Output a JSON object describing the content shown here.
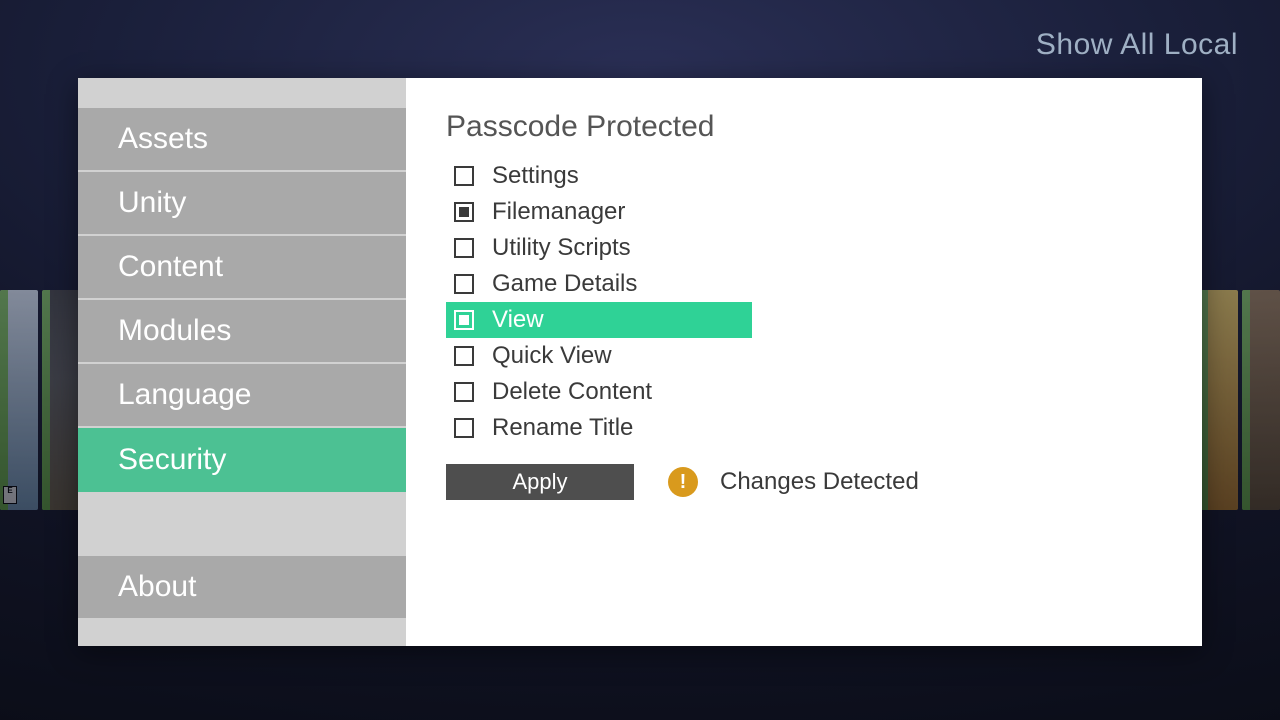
{
  "header": {
    "show_all_local": "Show All Local"
  },
  "sidebar": {
    "items": [
      {
        "label": "Assets",
        "active": false
      },
      {
        "label": "Unity",
        "active": false
      },
      {
        "label": "Content",
        "active": false
      },
      {
        "label": "Modules",
        "active": false
      },
      {
        "label": "Language",
        "active": false
      },
      {
        "label": "Security",
        "active": true
      }
    ],
    "about": {
      "label": "About"
    }
  },
  "main": {
    "title": "Passcode Protected",
    "options": [
      {
        "label": "Settings",
        "checked": false,
        "selected": false
      },
      {
        "label": "Filemanager",
        "checked": true,
        "selected": false
      },
      {
        "label": "Utility Scripts",
        "checked": false,
        "selected": false
      },
      {
        "label": "Game Details",
        "checked": false,
        "selected": false
      },
      {
        "label": "View",
        "checked": true,
        "selected": true
      },
      {
        "label": "Quick View",
        "checked": false,
        "selected": false
      },
      {
        "label": "Delete Content",
        "checked": false,
        "selected": false
      },
      {
        "label": "Rename Title",
        "checked": false,
        "selected": false
      }
    ],
    "apply_label": "Apply",
    "status_text": "Changes Detected",
    "warn_glyph": "!"
  },
  "colors": {
    "accent": "#4cc193",
    "accent_bright": "#2fd296",
    "warn": "#d99a1d",
    "button": "#4e4e4e"
  }
}
